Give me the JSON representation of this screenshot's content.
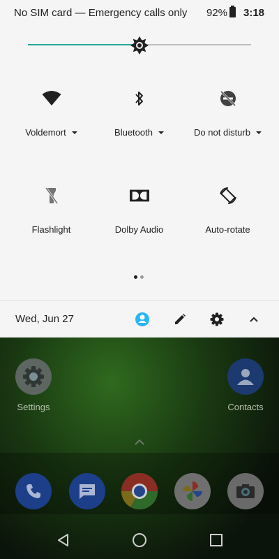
{
  "status_bar": {
    "carrier_text": "No SIM card — Emergency calls only",
    "battery": "92%",
    "time": "3:18"
  },
  "brightness": {
    "level": 0.5
  },
  "tiles": [
    {
      "label": "Voldemort",
      "icon": "wifi-icon",
      "has_dropdown": true
    },
    {
      "label": "Bluetooth",
      "icon": "bluetooth-icon",
      "has_dropdown": true
    },
    {
      "label": "Do not disturb",
      "icon": "do-not-disturb-icon",
      "has_dropdown": true
    },
    {
      "label": "Flashlight",
      "icon": "flashlight-icon",
      "has_dropdown": false
    },
    {
      "label": "Dolby Audio",
      "icon": "dolby-icon",
      "has_dropdown": false
    },
    {
      "label": "Auto-rotate",
      "icon": "auto-rotate-icon",
      "has_dropdown": false
    }
  ],
  "pager": {
    "pages": 2,
    "current": 1
  },
  "footer": {
    "date": "Wed, Jun 27",
    "icons": [
      "user-icon",
      "edit-icon",
      "settings-icon",
      "collapse-icon"
    ]
  },
  "home": {
    "apps": [
      {
        "label": "Settings"
      },
      {
        "label": "Contacts"
      }
    ],
    "dock": [
      "phone-icon",
      "messages-icon",
      "chrome-icon",
      "photos-icon",
      "camera-icon"
    ]
  },
  "colors": {
    "accent": "#26a69a",
    "user_icon": "#29b6f6",
    "panel_bg": "#f5f5f5"
  }
}
